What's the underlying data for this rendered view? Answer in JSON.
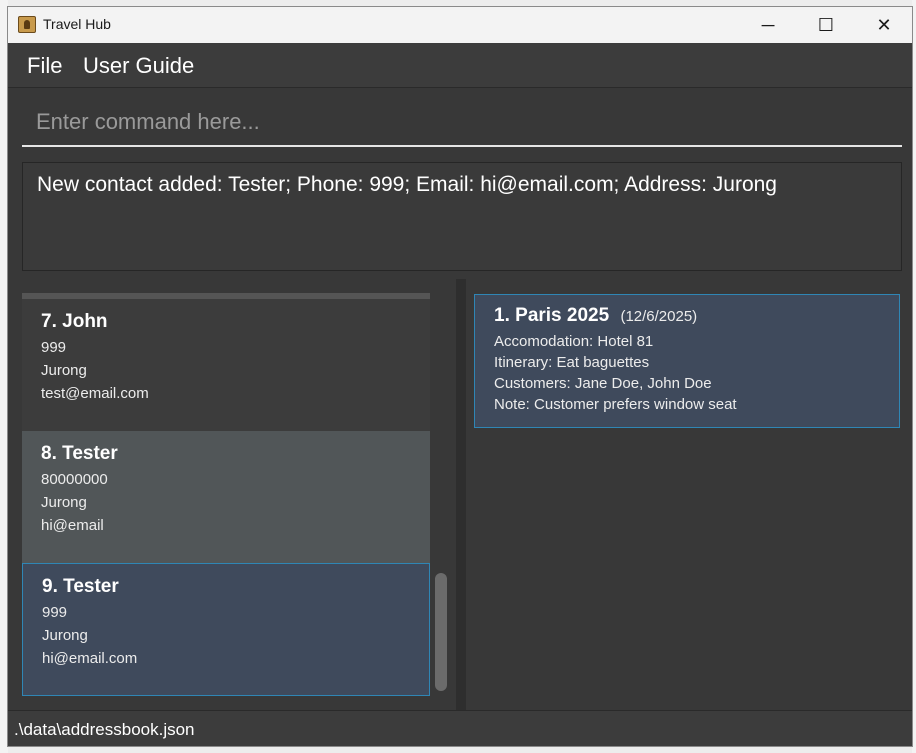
{
  "window": {
    "title": "Travel Hub",
    "minimize_glyph": "─",
    "maximize_glyph": "☐",
    "close_glyph": "✕"
  },
  "menu": {
    "file_label": "File",
    "guide_label": "User Guide"
  },
  "command": {
    "placeholder": "Enter command here..."
  },
  "result": {
    "text": "New contact added: Tester; Phone: 999; Email: hi@email.com; Address: Jurong"
  },
  "contacts": [
    {
      "index": "7.",
      "name": "John",
      "phone": "999",
      "address": "Jurong",
      "email": "test@email.com"
    },
    {
      "index": "8.",
      "name": "Tester",
      "phone": "80000000",
      "address": "Jurong",
      "email": "hi@email"
    },
    {
      "index": "9.",
      "name": "Tester",
      "phone": "999",
      "address": "Jurong",
      "email": "hi@email.com"
    }
  ],
  "trips": [
    {
      "index": "1.",
      "name": "Paris 2025",
      "date": "(12/6/2025)",
      "accommodation": "Accomodation: Hotel 81",
      "itinerary": "Itinerary: Eat baguettes",
      "customers": "Customers: Jane Doe, John Doe",
      "note": "Note: Customer prefers window seat"
    }
  ],
  "status": {
    "path": ".\\data\\addressbook.json"
  },
  "colors": {
    "background": "#383838",
    "selected_card": "#3f4a5c",
    "selected_border": "#2f86b5",
    "hover_card": "#515658"
  },
  "icons": {
    "app": "app-icon",
    "minimize": "minimize-icon",
    "maximize": "maximize-icon",
    "close": "close-icon"
  }
}
